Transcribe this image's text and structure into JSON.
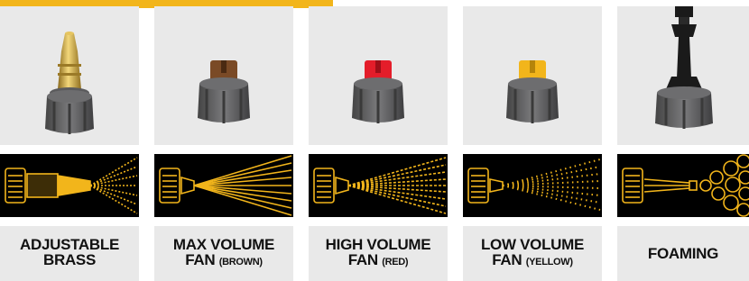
{
  "colors": {
    "accent": "#f2b51b",
    "panel_background": "#e9e9e9",
    "diagram_background": "#000000",
    "brass": "#c9a13c",
    "brown": "#7a4a26",
    "red": "#e41d2a",
    "yellow": "#f2b51b",
    "cap_gray": "#5f6062",
    "foaming_black": "#1a1a1a"
  },
  "nozzles": [
    {
      "id": "adjustable-brass",
      "line1": "ADJUSTABLE",
      "line2": "BRASS",
      "line2_sub": "",
      "icon": "adjustable-brass-nozzle-icon",
      "spray": "cone-spray-icon"
    },
    {
      "id": "max-volume-fan",
      "line1": "MAX VOLUME",
      "line2": "FAN ",
      "line2_sub": "(BROWN)",
      "icon": "brown-fan-nozzle-icon",
      "spray": "wide-fan-spray-icon"
    },
    {
      "id": "high-volume-fan",
      "line1": "HIGH VOLUME",
      "line2": "FAN ",
      "line2_sub": "(RED)",
      "icon": "red-fan-nozzle-icon",
      "spray": "dotted-fan-spray-icon"
    },
    {
      "id": "low-volume-fan",
      "line1": "LOW VOLUME",
      "line2": "FAN ",
      "line2_sub": "(YELLOW)",
      "icon": "yellow-fan-nozzle-icon",
      "spray": "mist-spray-icon"
    },
    {
      "id": "foaming",
      "line1": "FOAMING",
      "line2": "",
      "line2_sub": "",
      "icon": "foaming-nozzle-icon",
      "spray": "foam-bubbles-spray-icon"
    }
  ]
}
